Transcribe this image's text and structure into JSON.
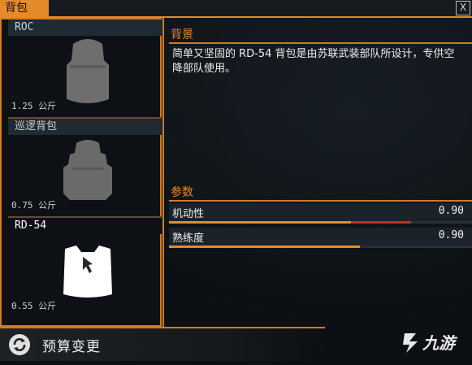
{
  "window": {
    "title": "背包",
    "close_label": "X"
  },
  "backpacks": [
    {
      "name": "ROC",
      "weight": "1.25 公斤",
      "selected": false
    },
    {
      "name": "巡逻背包",
      "weight": "0.75 公斤",
      "selected": false
    },
    {
      "name": "RD-54",
      "weight": "0.55 公斤",
      "selected": true
    }
  ],
  "details": {
    "background_heading": "背景",
    "description": "简单又坚固的 RD-54 背包是由苏联武装部队所设计，专供空降部队使用。",
    "params_heading": "参数",
    "stats": [
      {
        "label": "机动性",
        "value": "0.90",
        "fill": 0.6,
        "red_extra": 0.2
      },
      {
        "label": "熟练度",
        "value": "0.90",
        "fill": 0.63,
        "red_extra": 0.0
      }
    ]
  },
  "footer": {
    "budget_label": "预算变更"
  },
  "watermark": {
    "text": "九游"
  },
  "colors": {
    "accent": "#e58a2a",
    "red": "#c0302a",
    "panel": "#0d1115"
  }
}
